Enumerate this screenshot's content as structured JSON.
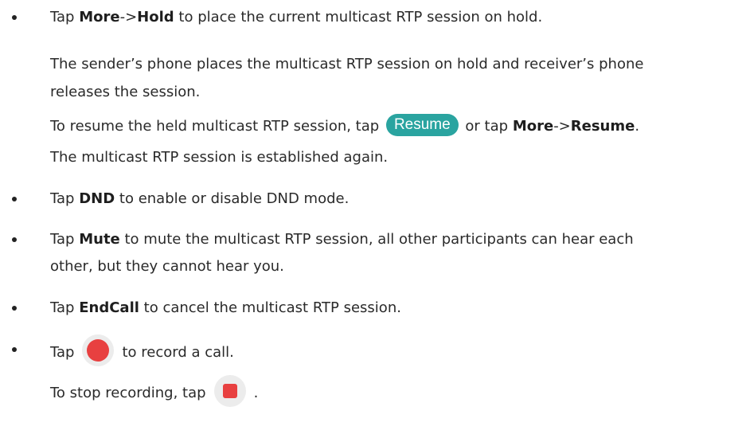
{
  "hold": {
    "tap": "Tap",
    "more": "More",
    "arrow": "->",
    "hold": "Hold",
    "rest": "to place the current multicast RTP session on hold.",
    "desc_line1": "The sender’s phone places the multicast RTP session on hold and receiver’s phone",
    "desc_line2": "releases the session.",
    "resume_prefix": "To resume the held multicast RTP session, tap",
    "resume_button": "Resume",
    "resume_or": "or tap",
    "resume_more": "More",
    "resume_arrow": "->",
    "resume_bold": "Resume",
    "resume_end": ".",
    "established": "The multicast RTP session is established again."
  },
  "dnd": {
    "tap": "Tap",
    "bold": "DND",
    "rest": "to enable or disable DND mode."
  },
  "mute": {
    "tap": "Tap",
    "bold": "Mute",
    "rest": "to mute the multicast RTP session, all other participants can hear each",
    "line2": "other, but they cannot hear you."
  },
  "endcall": {
    "tap": "Tap",
    "bold": "EndCall",
    "rest": "to cancel the multicast RTP session."
  },
  "record": {
    "tap": "Tap",
    "rest": "to record a call.",
    "stop_prefix": "To stop recording, tap",
    "stop_end": ".",
    "icon_color": "#e84040"
  }
}
